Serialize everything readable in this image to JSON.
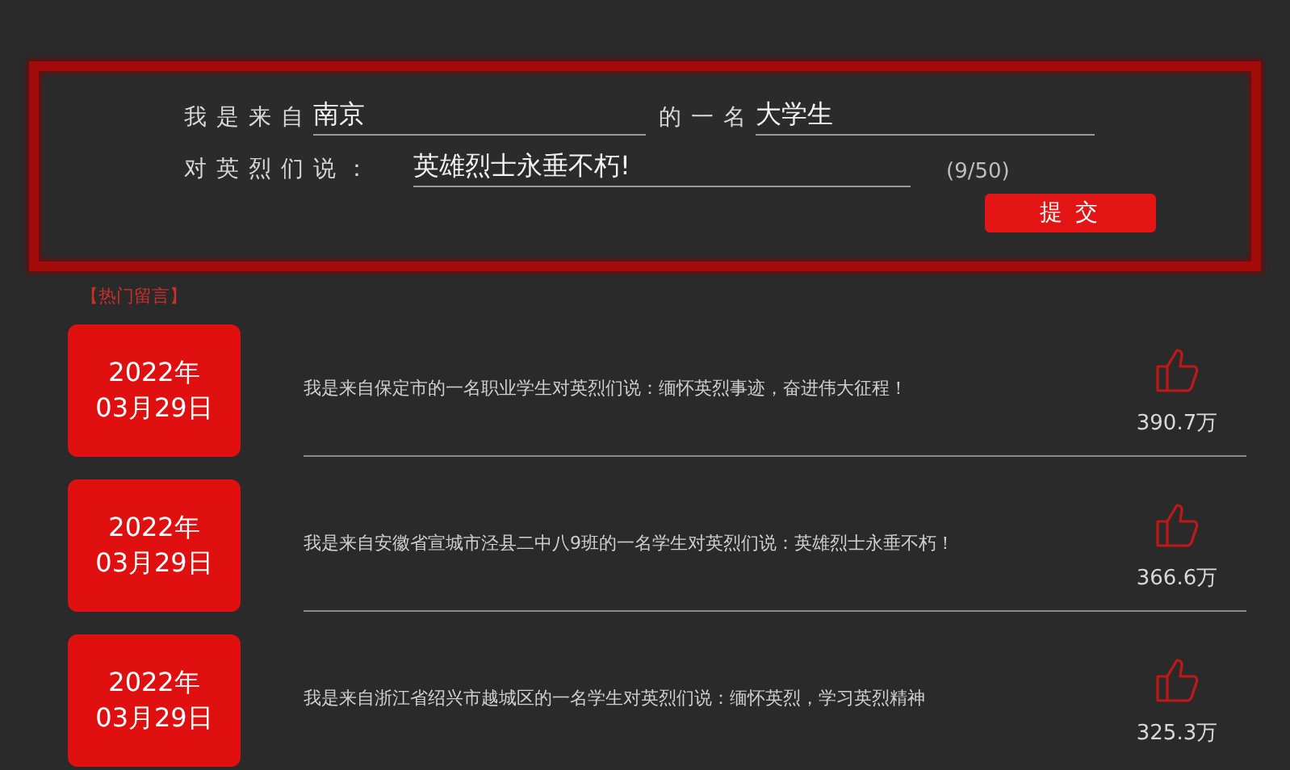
{
  "form": {
    "from_label": "我是来自",
    "city": {
      "value": "南京"
    },
    "role_label": "的一名",
    "role": {
      "value": "大学生"
    },
    "message_label": "对英烈们说：",
    "message": {
      "value": "英雄烈士永垂不朽!"
    },
    "counter": "(9/50)",
    "submit": "提 交"
  },
  "section_title": "【热门留言】",
  "comments": [
    {
      "year": "2022年",
      "date": "03月29日",
      "text": "我是来自保定市的一名职业学生对英烈们说：缅怀英烈事迹，奋进伟大征程！",
      "likes": "390.7万",
      "divider": true
    },
    {
      "year": "2022年",
      "date": "03月29日",
      "text": "我是来自安徽省宣城市泾县二中八9班的一名学生对英烈们说：英雄烈士永垂不朽！",
      "likes": "366.6万",
      "divider": true
    },
    {
      "year": "2022年",
      "date": "03月29日",
      "text": "我是来自浙江省绍兴市越城区的一名学生对英烈们说：缅怀英烈，学习英烈精神",
      "likes": "325.3万",
      "divider": false
    }
  ]
}
